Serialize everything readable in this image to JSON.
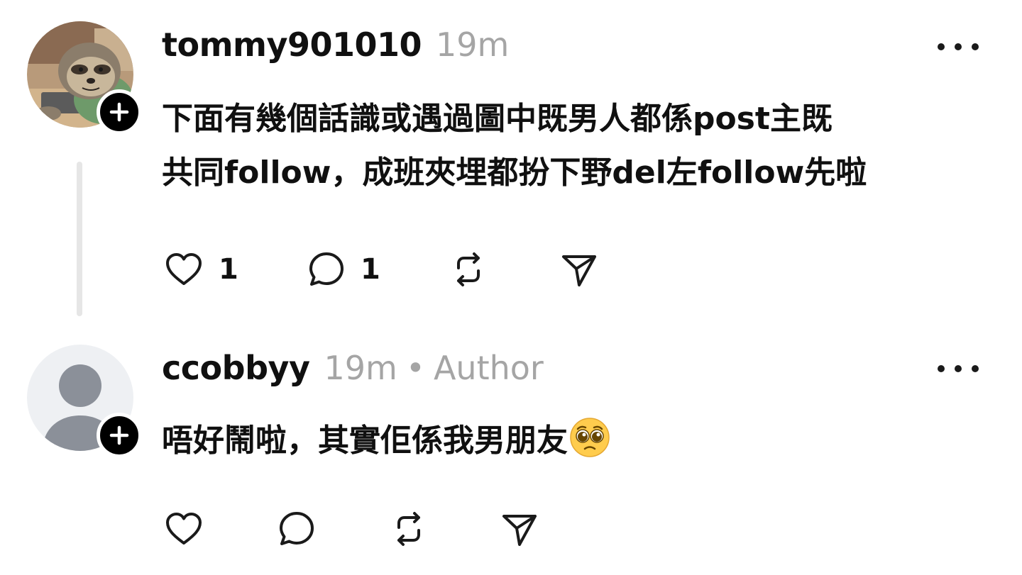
{
  "posts": [
    {
      "username": "tommy901010",
      "time": "19m",
      "badge": "",
      "text": "下面有幾個話識或遇過圖中既男人都係post主既\n共同follow，成班夾埋都扮下野del左follow先啦",
      "emoji": "",
      "likes": "1",
      "replies": "1",
      "avatar_icon": "sloth-avatar",
      "has_thread_line": true
    },
    {
      "username": "ccobbyy",
      "time": "19m",
      "badge_separator": "•",
      "badge": "Author",
      "text": "唔好鬧啦，其實佢係我男朋友",
      "emoji": "pleading-face",
      "likes": "",
      "replies": "",
      "avatar_icon": "default-user-avatar",
      "has_thread_line": false
    }
  ],
  "colors": {
    "text_primary": "#101010",
    "text_secondary": "#a5a5a5",
    "thread_line": "#e6e6e6",
    "badge_bg": "#000000",
    "avatar_default_bg": "#eef0f3",
    "avatar_default_fg": "#8b9099"
  },
  "icons": {
    "more": "more-horizontal-icon",
    "like": "heart-icon",
    "reply": "comment-icon",
    "repost": "repost-icon",
    "share": "send-icon",
    "follow": "plus-icon"
  }
}
